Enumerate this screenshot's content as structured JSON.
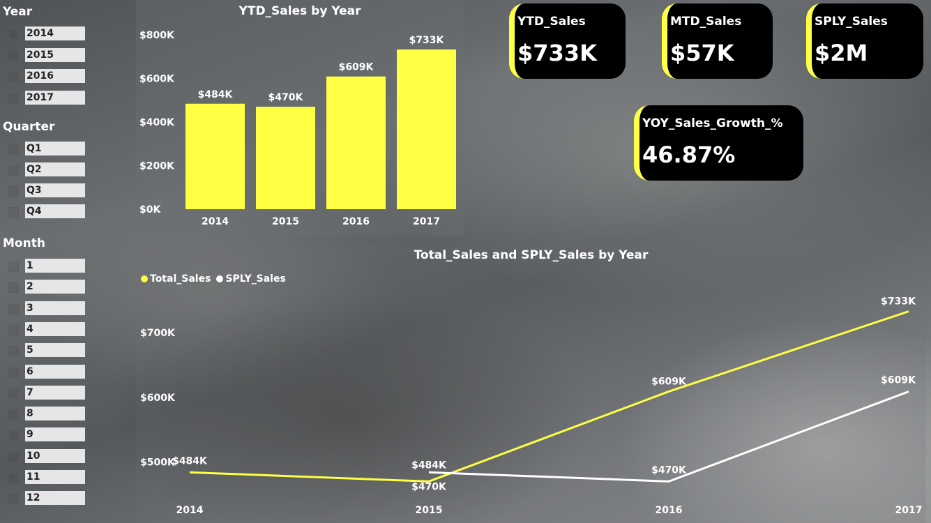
{
  "slicers": {
    "year": {
      "title": "Year",
      "items": [
        "2014",
        "2015",
        "2016",
        "2017"
      ]
    },
    "quarter": {
      "title": "Quarter",
      "items": [
        "Q1",
        "Q2",
        "Q3",
        "Q4"
      ]
    },
    "month": {
      "title": "Month",
      "items": [
        "1",
        "2",
        "3",
        "4",
        "5",
        "6",
        "7",
        "8",
        "9",
        "10",
        "11",
        "12"
      ]
    }
  },
  "cards": {
    "ytd": {
      "label": "YTD_Sales",
      "value": "$733K"
    },
    "mtd": {
      "label": "MTD_Sales",
      "value": "$57K"
    },
    "sply": {
      "label": "SPLY_Sales",
      "value": "$2M"
    },
    "yoy": {
      "label": "YOY_Sales_Growth_%",
      "value": "46.87%"
    }
  },
  "colors": {
    "accent": "#ffff44",
    "secondary": "#ffffff",
    "card_bg": "#000000"
  },
  "chart_data": [
    {
      "type": "bar",
      "title": "YTD_Sales by Year",
      "categories": [
        "2014",
        "2015",
        "2016",
        "2017"
      ],
      "values": [
        484,
        470,
        609,
        733
      ],
      "data_labels": [
        "$484K",
        "$470K",
        "$609K",
        "$733K"
      ],
      "y_ticks": [
        "$0K",
        "$200K",
        "$400K",
        "$600K",
        "$800K"
      ],
      "ylim": [
        0,
        800
      ],
      "unit": "K$"
    },
    {
      "type": "line",
      "title": "Total_Sales and SPLY_Sales by Year",
      "categories": [
        "2014",
        "2015",
        "2016",
        "2017"
      ],
      "series": [
        {
          "name": "Total_Sales",
          "values": [
            484,
            470,
            609,
            733
          ],
          "labels": [
            "$484K",
            "$470K",
            "$609K",
            "$733K"
          ]
        },
        {
          "name": "SPLY_Sales",
          "values": [
            null,
            484,
            470,
            609
          ],
          "labels": [
            "",
            "$484K",
            "$470K",
            "$609K"
          ]
        }
      ],
      "y_ticks": [
        "$500K",
        "$600K",
        "$700K"
      ],
      "y_tick_values": [
        500,
        600,
        700
      ],
      "ylim": [
        465,
        740
      ],
      "legend": "top-left"
    }
  ]
}
